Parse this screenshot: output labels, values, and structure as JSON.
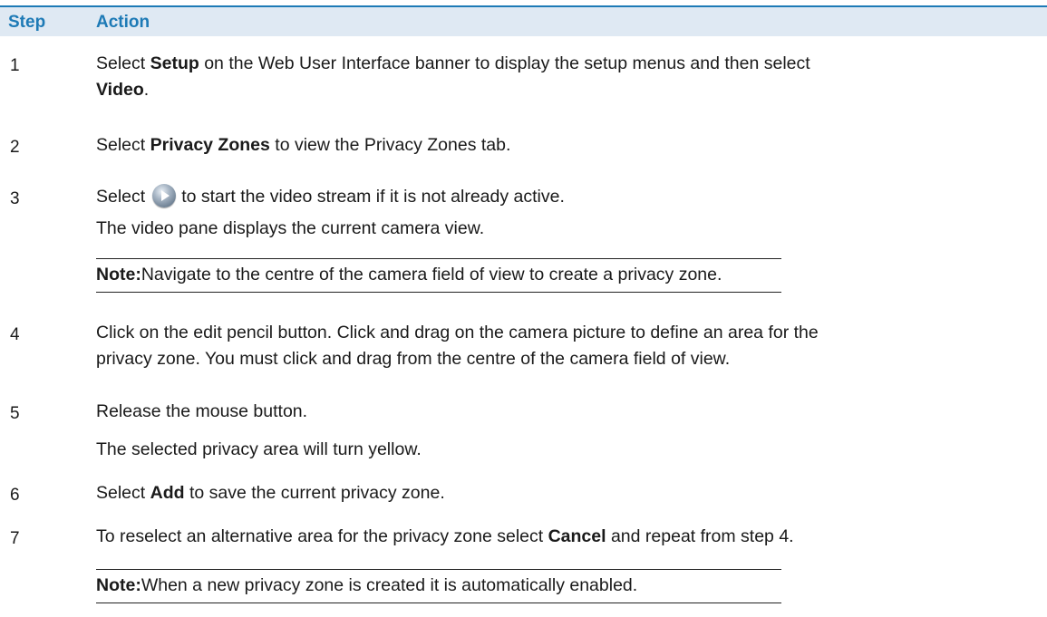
{
  "table": {
    "header": {
      "step": "Step",
      "action": "Action"
    },
    "rows": [
      {
        "num": "1",
        "parts": [
          "Select ",
          "Setup",
          " on the Web User Interface banner to display the setup menus and then select",
          "Video",
          "."
        ]
      },
      {
        "num": "2",
        "parts": [
          "Select ",
          "Privacy Zones",
          " to view the Privacy Zones tab."
        ]
      },
      {
        "num": "3",
        "parts": [
          "Select",
          "to start the video stream if it is not already active."
        ],
        "icon": "play-button-icon",
        "extra": "The video pane displays the current camera view.",
        "note": {
          "label": "Note:",
          "text": "Navigate to the centre of the camera field of view to create a privacy zone."
        }
      },
      {
        "num": "4",
        "lines": [
          "Click on the edit pencil button. Click and drag on the camera picture to define an area for the",
          "privacy zone. You must click and drag from the centre of the camera field of view."
        ]
      },
      {
        "num": "5",
        "text": "Release the mouse button.",
        "extra": "The selected privacy area will turn yellow."
      },
      {
        "num": "6",
        "parts": [
          "Select ",
          "Add",
          " to save the current privacy zone."
        ]
      },
      {
        "num": "7",
        "parts": [
          "To reselect an alternative area for the privacy zone select ",
          "Cancel",
          " and repeat from step 4."
        ],
        "note": {
          "label": "Note:",
          "text": "When a new privacy zone is created it is automatically enabled."
        }
      }
    ]
  },
  "colors": {
    "accent": "#1d7ab6",
    "header_bg": "#dfe9f3"
  }
}
